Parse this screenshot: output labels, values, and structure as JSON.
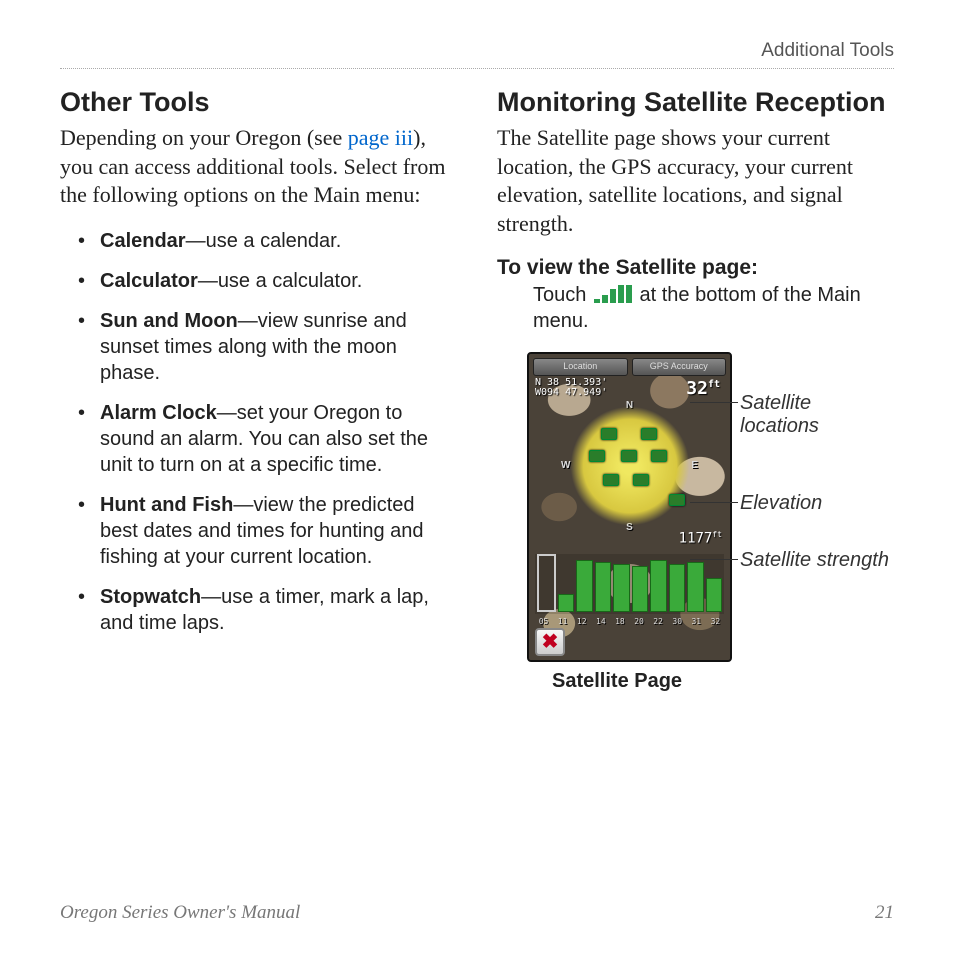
{
  "header": {
    "section": "Additional Tools"
  },
  "left": {
    "heading": "Other Tools",
    "intro_pre": "Depending on your Oregon (see ",
    "intro_link": "page iii",
    "intro_post": "), you can access additional tools. Select from the following options on the Main menu:",
    "tools": [
      {
        "name": "Calendar",
        "desc": "—use a calendar."
      },
      {
        "name": "Calculator",
        "desc": "—use a calculator."
      },
      {
        "name": "Sun and Moon",
        "desc": "—view sunrise and sunset times along with the moon phase."
      },
      {
        "name": "Alarm Clock",
        "desc": "—set your Oregon to sound an alarm. You can also set the unit to turn on at a specific time."
      },
      {
        "name": "Hunt and Fish",
        "desc": "—view the predicted best dates and times for hunting and fishing at your current location."
      },
      {
        "name": "Stopwatch",
        "desc": "—use a timer, mark a lap, and time laps."
      }
    ]
  },
  "right": {
    "heading": "Monitoring Satellite Reception",
    "body": "The Satellite page shows your current location, the GPS accuracy, your current elevation, satellite locations, and signal strength.",
    "instr_head": "To view the Satellite page:",
    "instr_pre": "Touch ",
    "instr_post": " at the bottom of the Main menu.",
    "annotations": {
      "a1": "Satellite locations",
      "a2": "Elevation",
      "a3": "Satellite strength"
    },
    "caption": "Satellite Page",
    "device": {
      "tab1": "Location",
      "tab2": "GPS Accuracy",
      "coord1": "N 38 51.393'",
      "coord2": "W094 47.949'",
      "accuracy": "32",
      "accuracy_unit": "ft",
      "elev": "1177",
      "elev_unit": "ft",
      "close": "✖",
      "bar_ids": [
        "05",
        "11",
        "12",
        "14",
        "18",
        "20",
        "22",
        "30",
        "31",
        "32"
      ],
      "compass": {
        "n": "N",
        "s": "S",
        "e": "E",
        "w": "W"
      }
    }
  },
  "footer": {
    "title": "Oregon Series Owner's Manual",
    "page": "21"
  }
}
